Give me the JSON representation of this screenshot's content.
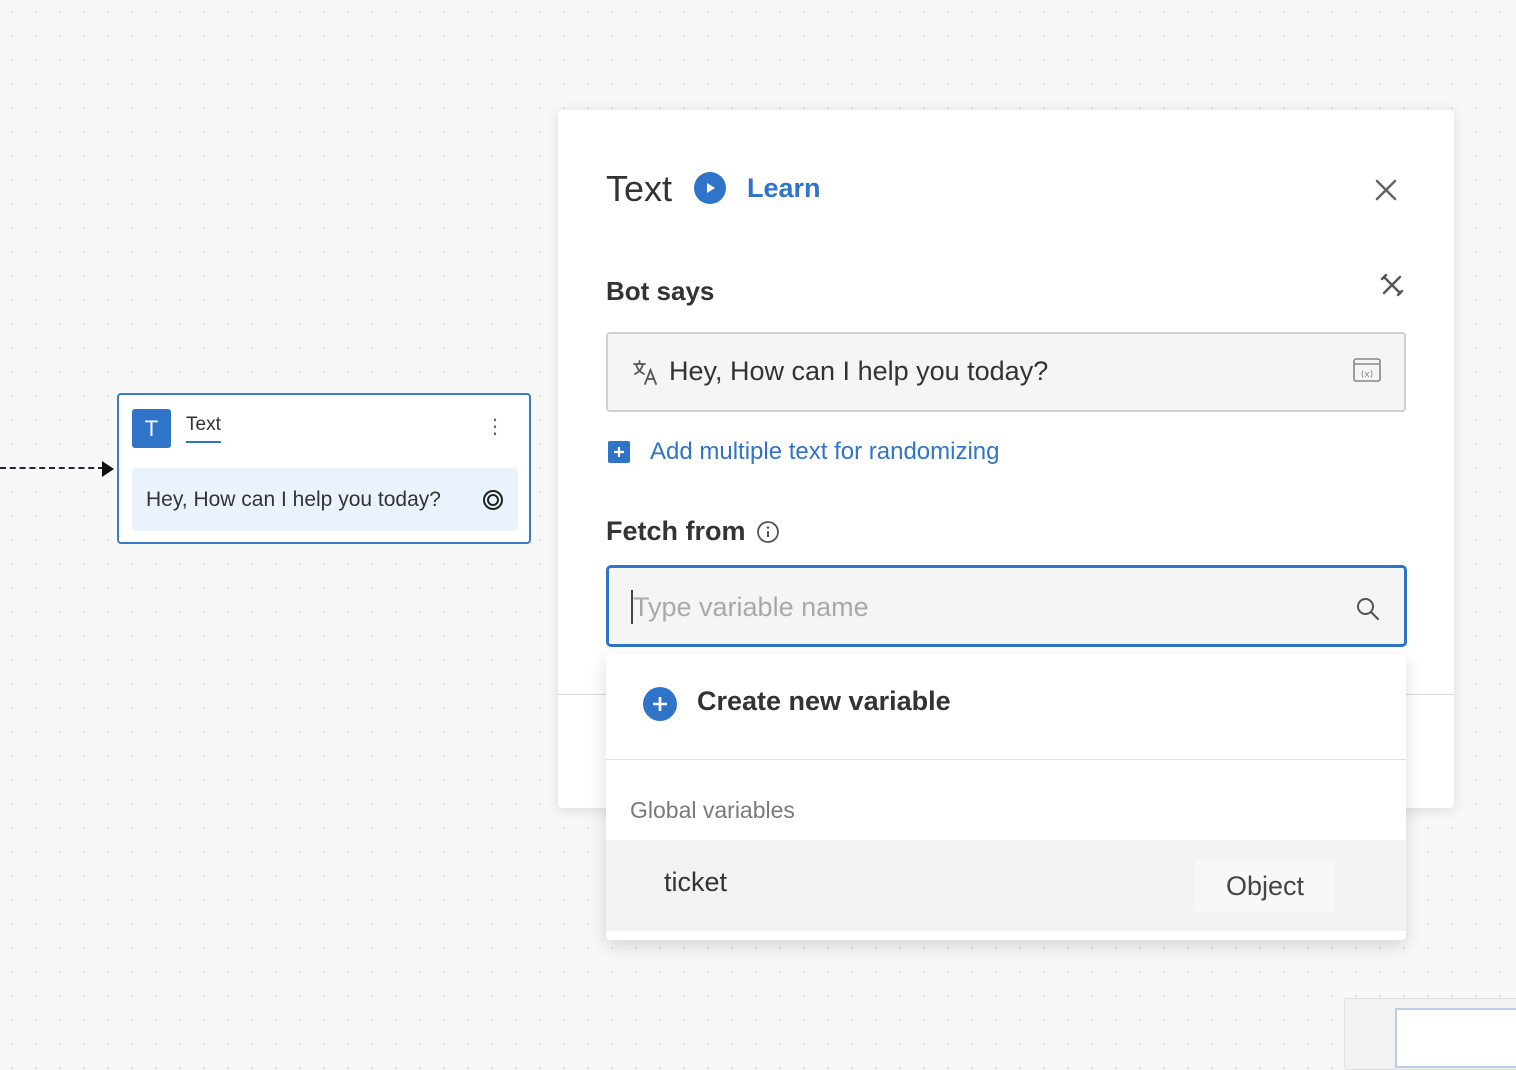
{
  "canvas": {
    "node": {
      "badge": "T",
      "title": "Text",
      "message": "Hey, How can I help you today?",
      "menu_icon": "more-vertical-icon",
      "target_icon": "target-icon"
    }
  },
  "panel": {
    "title": "Text",
    "learn_label": "Learn",
    "bot_says_label": "Bot says",
    "bot_says_value": "Hey, How can I help you today?",
    "add_random_label": "Add multiple text for randomizing",
    "fetch_label": "Fetch from",
    "fetch_placeholder": "Type variable name"
  },
  "dropdown": {
    "create_label": "Create new variable",
    "group_label": "Global variables",
    "variables": [
      {
        "name": "ticket",
        "type": "Object"
      }
    ]
  },
  "colors": {
    "accent": "#2f74c8",
    "background": "#f8f8f8"
  }
}
